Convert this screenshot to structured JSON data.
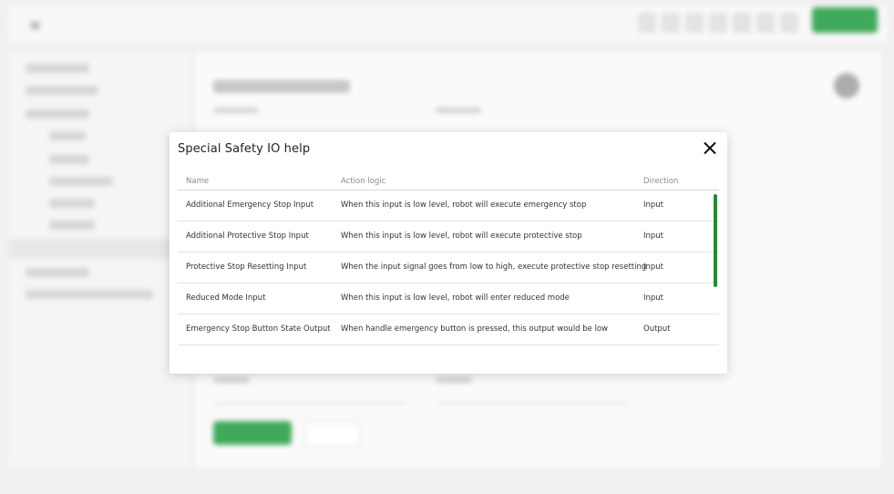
{
  "modal": {
    "title": "Special Safety IO help",
    "columns": [
      "Name",
      "Action logic",
      "Direction"
    ],
    "rows": [
      {
        "name": "Additional Emergency Stop Input",
        "logic": "When this input is low level, robot will execute emergency stop",
        "direction": "Input"
      },
      {
        "name": "Additional Protective Stop Input",
        "logic": "When this input is low level, robot will execute protective stop",
        "direction": "Input"
      },
      {
        "name": "Protective Stop Resetting Input",
        "logic": "When the input signal goes from low to high, execute protective stop resetting",
        "direction": "Input"
      },
      {
        "name": "Reduced Mode Input",
        "logic": "When this input is low level, robot will enter reduced mode",
        "direction": "Input"
      },
      {
        "name": "Emergency Stop Button State Output",
        "logic": "When handle emergency button is pressed, this output would be low",
        "direction": "Output"
      }
    ]
  },
  "colors": {
    "accent_green": "#1f9b3e",
    "scrollbar_green": "#1f8f2f"
  },
  "icons": {
    "close": "close-icon",
    "menu": "menu-icon"
  }
}
